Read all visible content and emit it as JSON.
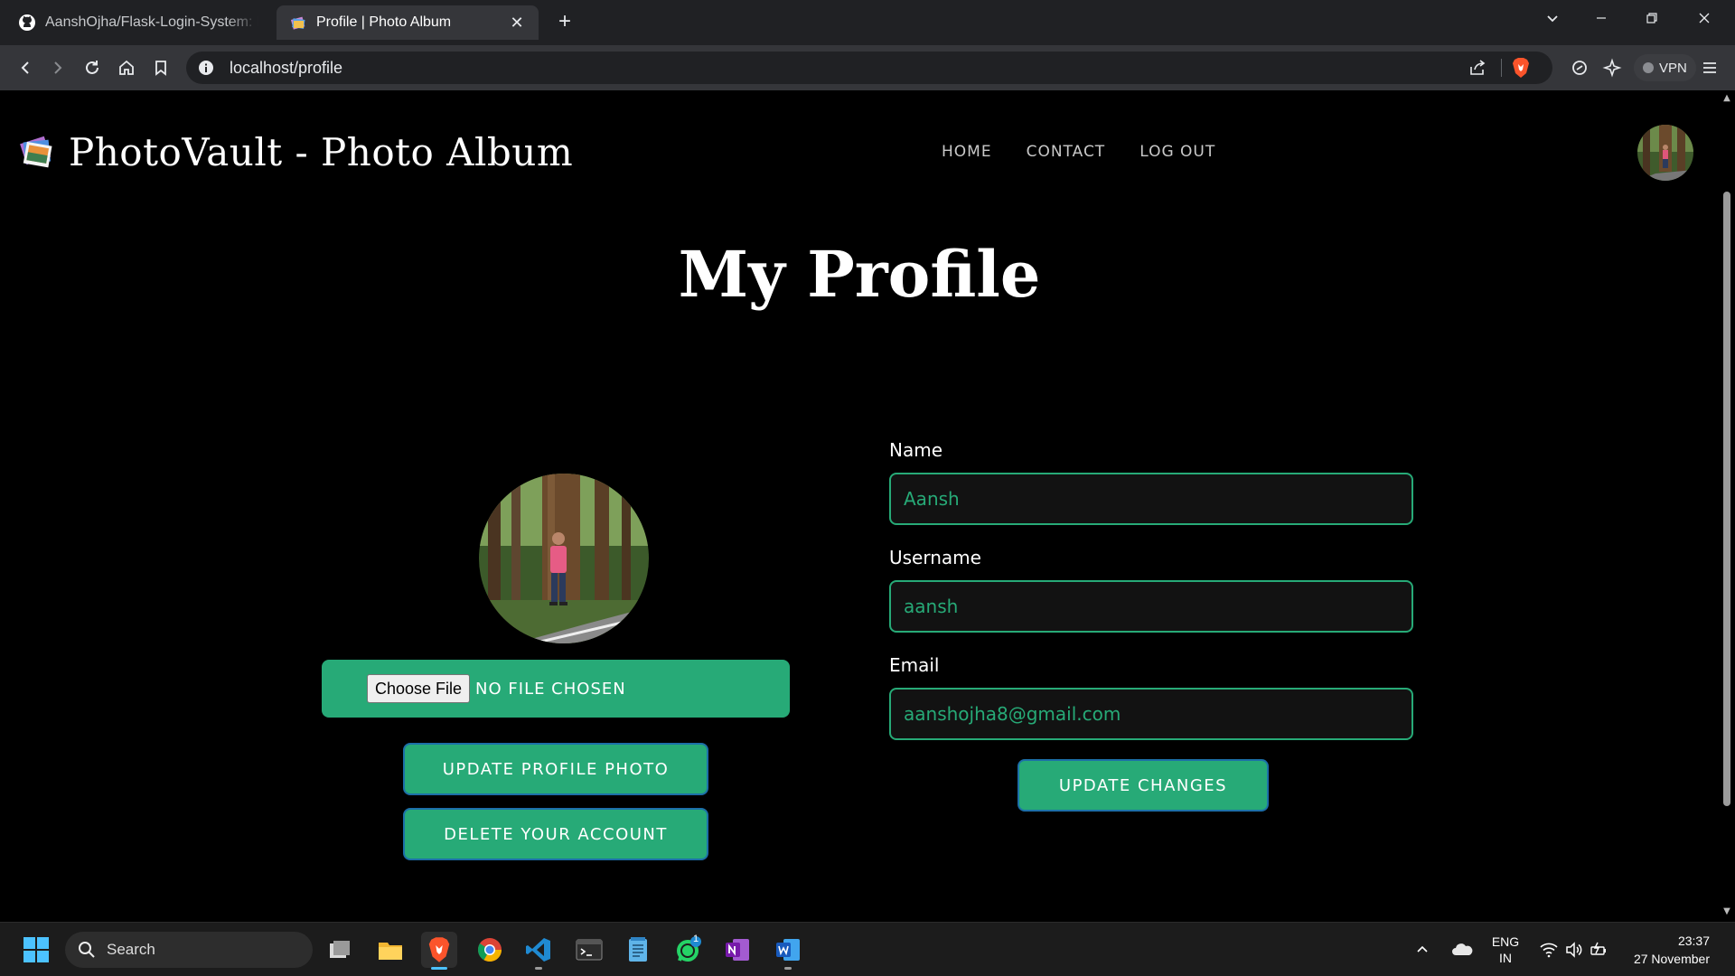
{
  "browser": {
    "tabs": [
      {
        "title": "AanshOjha/Flask-Login-System: Pho",
        "active": false,
        "icon": "github-icon"
      },
      {
        "title": "Profile | Photo Album",
        "active": true,
        "icon": "photovault-favicon"
      }
    ],
    "new_tab": "+",
    "url": "localhost/profile",
    "vpn_label": "VPN"
  },
  "site": {
    "brand": "PhotoVault - Photo Album",
    "nav": [
      "HOME",
      "CONTACT",
      "LOG OUT"
    ]
  },
  "profile": {
    "page_title": "My Profile",
    "choose_file_label": "Choose File",
    "no_file_label": "NO FILE CHOSEN",
    "update_photo_label": "UPDATE PROFILE PHOTO",
    "delete_account_label": "DELETE YOUR ACCOUNT",
    "fields": [
      {
        "label": "Name",
        "value": "Aansh"
      },
      {
        "label": "Username",
        "value": "aansh"
      },
      {
        "label": "Email",
        "value": "aanshojha8@gmail.com"
      }
    ],
    "update_changes_label": "UPDATE CHANGES"
  },
  "taskbar": {
    "search_label": "Search",
    "lang_top": "ENG",
    "lang_bottom": "IN",
    "time": "23:37",
    "date": "27 November",
    "whatsapp_badge": "1"
  },
  "colors": {
    "accent": "#27aa77",
    "button_border": "#1c6fa8",
    "page_bg": "#000000"
  }
}
